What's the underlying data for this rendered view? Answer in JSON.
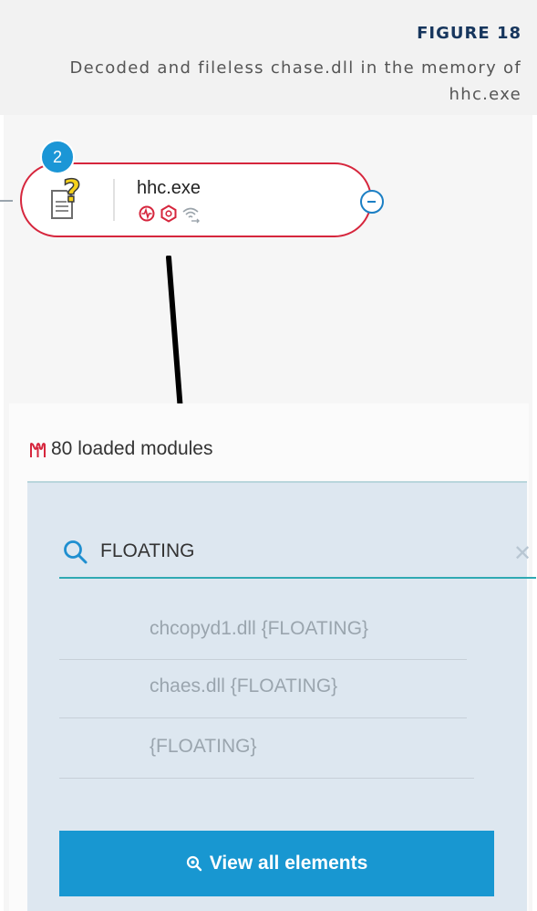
{
  "caption": {
    "figure_label": "FIGURE 18",
    "description": "Decoded and fileless chase.dll in the memory of hhc.exe"
  },
  "process_node": {
    "badge_count": "2",
    "name": "hhc.exe",
    "icon": "unknown-file-icon",
    "flag_icons": [
      "activity-icon",
      "threat-hexagon-icon",
      "network-icon"
    ],
    "border_color": "#d6263d",
    "badge_color": "#1b96d6"
  },
  "modules_panel": {
    "icon": "modules-icon",
    "title": "80 loaded modules",
    "search": {
      "value": "FLOATING",
      "icon": "search-icon",
      "clear_icon": "close-icon"
    },
    "results": [
      "chcopyd1.dll {FLOATING}",
      "chaes.dll {FLOATING}",
      "{FLOATING}"
    ],
    "view_all_label": "View all elements",
    "button_color": "#1897d1"
  }
}
